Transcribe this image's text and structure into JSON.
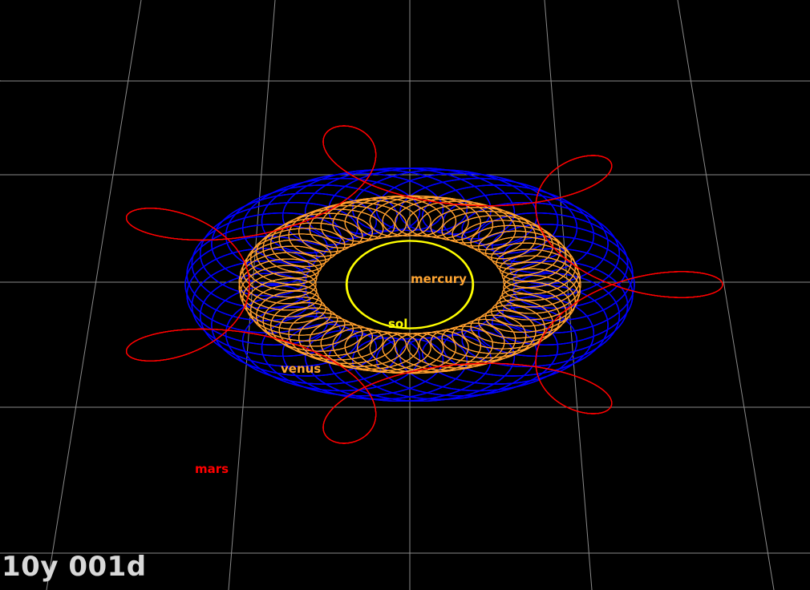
{
  "time": {
    "readout": "10y 001d"
  },
  "bodies": [
    {
      "id": "sol",
      "label": "sol",
      "color": "#ffff00"
    },
    {
      "id": "mercury",
      "label": "mercury",
      "color": "#ffa533"
    },
    {
      "id": "venus",
      "label": "venus",
      "color": "#ffa533"
    },
    {
      "id": "mars",
      "label": "mars",
      "color": "#ff0000"
    }
  ],
  "trails": {
    "sol": {
      "color": "#ffff00"
    },
    "mercury": {
      "color": "#ff9f2e"
    },
    "venus": {
      "color": "#0000ff"
    },
    "mars": {
      "color": "#ff0000"
    }
  },
  "grid": {
    "color": "#8a8a8a",
    "visible": true
  }
}
